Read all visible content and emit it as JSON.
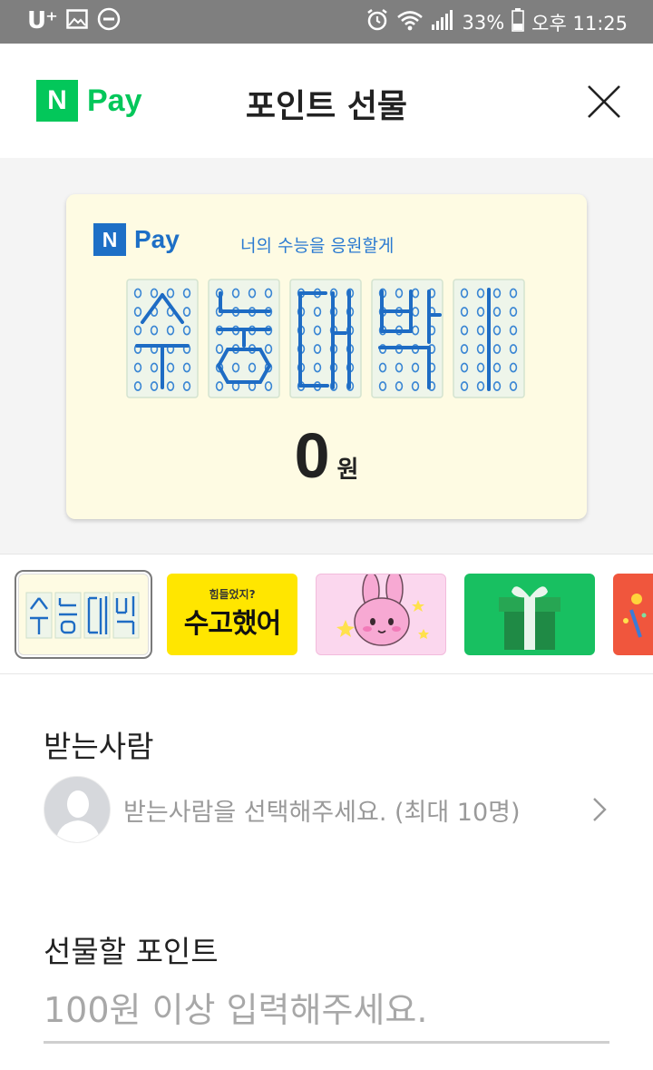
{
  "status_bar": {
    "carrier": "U⁺",
    "battery_percent": "33%",
    "time": "오후 11:25",
    "left_icons": [
      "image-icon",
      "do-not-disturb-icon"
    ],
    "right_icons": [
      "alarm-icon",
      "wifi-icon",
      "signal-icon",
      "battery-icon"
    ]
  },
  "header": {
    "logo_n": "N",
    "logo_pay": "Pay",
    "title": "포인트 선물",
    "close_icon": "close-icon"
  },
  "gift_card": {
    "logo_n": "N",
    "logo_pay": "Pay",
    "slogan": "너의 수능을 응원할게",
    "dot_art_text": "수능대박",
    "amount_value": "0",
    "amount_unit": "원"
  },
  "thumbnails": [
    {
      "name": "수능대박",
      "selected": true
    },
    {
      "name": "수고했어",
      "top_text": "힘들었지?",
      "main_text": "수고했어",
      "selected": false
    },
    {
      "name": "bunny-character",
      "selected": false
    },
    {
      "name": "gift-box",
      "selected": false
    },
    {
      "name": "celebration",
      "selected": false
    }
  ],
  "recipient": {
    "label": "받는사람",
    "placeholder": "받는사람을 선택해주세요. (최대 10명)"
  },
  "points": {
    "label": "선물할 포인트",
    "placeholder": "100원 이상 입력해주세요.",
    "value": ""
  },
  "colors": {
    "npay_green": "#03c75a",
    "card_blue": "#1d6fc6",
    "card_bg": "#fefbe3",
    "status_bar_bg": "#7f7f7f"
  }
}
